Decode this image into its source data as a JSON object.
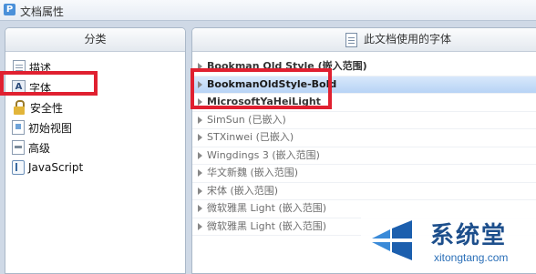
{
  "window": {
    "title": "文档属性",
    "icon": "pdf-app-icon"
  },
  "left_panel": {
    "header": "分类",
    "items": [
      {
        "label": "描述",
        "icon": "description-icon"
      },
      {
        "label": "字体",
        "icon": "font-icon"
      },
      {
        "label": "安全性",
        "icon": "lock-icon"
      },
      {
        "label": "初始视图",
        "icon": "initial-view-icon"
      },
      {
        "label": "高级",
        "icon": "advanced-icon"
      },
      {
        "label": "JavaScript",
        "icon": "javascript-icon"
      }
    ]
  },
  "right_panel": {
    "header": "此文档使用的字体",
    "fonts": [
      {
        "label": "Bookman Old Style (嵌入范围)"
      },
      {
        "label": "BookmanOldStyle-Bold"
      },
      {
        "label": "MicrosoftYaHeiLight"
      },
      {
        "label": "SimSun (已嵌入)"
      },
      {
        "label": "STXinwei (已嵌入)"
      },
      {
        "label": "Wingdings 3 (嵌入范围)"
      },
      {
        "label": "华文新魏 (嵌入范围)"
      },
      {
        "label": "宋体 (嵌入范围)"
      },
      {
        "label": "微软雅黑 Light (嵌入范围)"
      },
      {
        "label": "微软雅黑 Light (嵌入范围)"
      }
    ]
  },
  "watermark": {
    "title": "系统堂",
    "url": "xitongtang.com"
  },
  "colors": {
    "highlight_red": "#e02030",
    "selection_blue": "#b7d3f5",
    "watermark_blue": "#1d4f8c"
  }
}
